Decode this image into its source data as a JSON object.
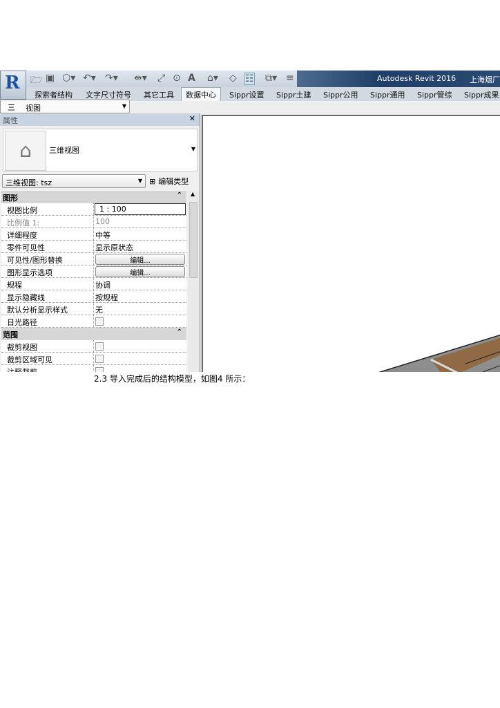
{
  "app": {
    "title": "Autodesk Revit 2016",
    "title_extra": "上海烟厂",
    "logo": "R"
  },
  "ribbon_tabs": [
    "探索者结构",
    "文字尺寸符号",
    "其它工具",
    "数据中心",
    "Sippr设置",
    "Sippr土建",
    "Sippr公用",
    "Sippr通用",
    "Sippr管综",
    "Sippr成果"
  ],
  "active_tab": "数据中心",
  "view_selector": {
    "icon": "三",
    "value": "视图"
  },
  "properties": {
    "title": "属性",
    "close": "✕",
    "type_name": "三维视图",
    "instance": "三维视图: tsz",
    "edit_type": "编辑类型",
    "sections": [
      {
        "name": "图形",
        "rows": [
          {
            "key": "视图比例",
            "value": "1 : 100",
            "kind": "input"
          },
          {
            "key": "比例值 1:",
            "value": "100",
            "kind": "dim"
          },
          {
            "key": "详细程度",
            "value": "中等"
          },
          {
            "key": "零件可见性",
            "value": "显示原状态"
          },
          {
            "key": "可见性/图形替换",
            "value": "编辑...",
            "kind": "button"
          },
          {
            "key": "图形显示选项",
            "value": "编辑...",
            "kind": "button"
          },
          {
            "key": "规程",
            "value": "协调"
          },
          {
            "key": "显示隐藏线",
            "value": "按规程"
          },
          {
            "key": "默认分析显示样式",
            "value": "无"
          },
          {
            "key": "日光路径",
            "value": "",
            "kind": "checkbox"
          }
        ]
      },
      {
        "name": "范围",
        "rows": [
          {
            "key": "裁剪视图",
            "value": "",
            "kind": "checkbox"
          },
          {
            "key": "裁剪区域可见",
            "value": "",
            "kind": "checkbox"
          },
          {
            "key": "注释裁剪",
            "value": "",
            "kind": "checkbox"
          }
        ]
      }
    ]
  },
  "caption": "2.3 导入完成后的结构模型，如图4 所示：",
  "colors": {
    "model_brown": "#8f6a45",
    "model_gray": "#8e8e8e",
    "titlebar": "#1f3f66"
  }
}
